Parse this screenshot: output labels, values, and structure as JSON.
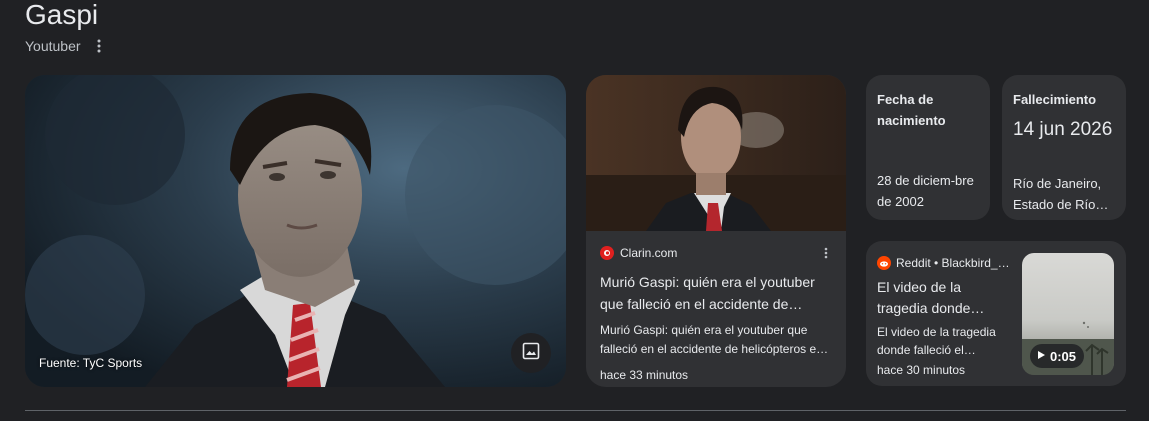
{
  "header": {
    "title": "Gaspi",
    "subtitle": "Youtuber"
  },
  "main_image": {
    "source_label": "Fuente: TyC Sports",
    "button_icon": "image-icon"
  },
  "article": {
    "source": "Clarin.com",
    "title": "Murió Gaspi: quién era el youtuber que falleció en el accidente de…",
    "snippet": "Murió Gaspi: quién era el youtuber que falleció en el accidente de helicópteros e…",
    "time": "hace 33 minutos"
  },
  "facts": {
    "birth": {
      "label": "Fecha de nacimiento",
      "value": "28 de diciem-bre de 2002"
    },
    "death": {
      "label": "Fallecimiento",
      "date": "14 jun 2026",
      "place": "Río de Janeiro, Estado de Río…"
    }
  },
  "video": {
    "source": "Reddit • Blackbird_…",
    "title": "El video de la tragedia donde…",
    "snippet": "El video de la tragedia donde falleció el…",
    "time": "hace 30 minutos",
    "duration": "0:05"
  },
  "colors": {
    "background": "#202124",
    "card": "#303134",
    "text": "#e8eaed",
    "clarin_red": "#e0201f",
    "reddit_orange": "#ff4500"
  }
}
